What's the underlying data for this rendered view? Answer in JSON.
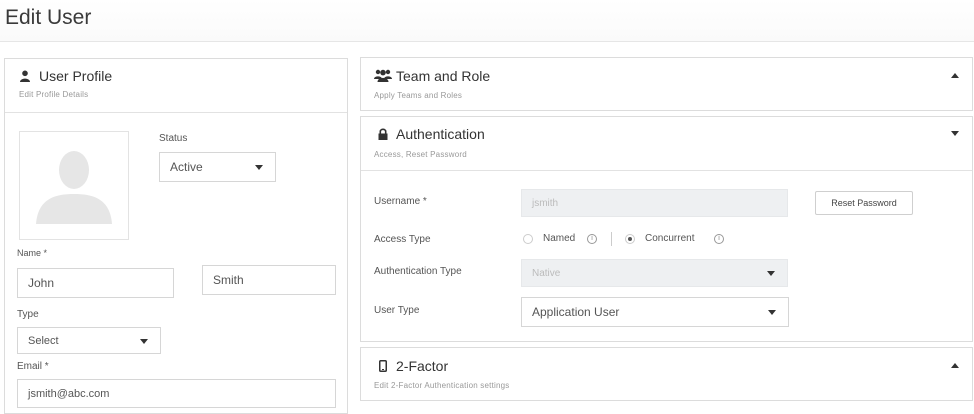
{
  "page": {
    "title": "Edit User"
  },
  "profile": {
    "title": "User Profile",
    "subtitle": "Edit Profile Details",
    "status_label": "Status",
    "status_value": "Active",
    "name_label": "Name *",
    "first_name": "John",
    "last_name": "Smith",
    "type_label": "Type",
    "type_value": "Select",
    "email_label": "Email *",
    "email_value": "jsmith@abc.com"
  },
  "team_role": {
    "title": "Team and Role",
    "subtitle": "Apply Teams and Roles"
  },
  "authentication": {
    "title": "Authentication",
    "subtitle": "Access, Reset Password",
    "username_label": "Username *",
    "username_placeholder": "jsmith",
    "reset_button": "Reset Password",
    "access_type_label": "Access Type",
    "access_named": "Named",
    "access_concurrent": "Concurrent",
    "access_selected": "Concurrent",
    "auth_type_label": "Authentication Type",
    "auth_type_value": "Native",
    "user_type_label": "User Type",
    "user_type_value": "Application User"
  },
  "two_factor": {
    "title": "2-Factor",
    "subtitle": "Edit 2-Factor Authentication settings"
  },
  "icons": {
    "profile": "user-icon",
    "team": "users-icon",
    "auth": "lock-icon",
    "two_factor": "mobile-icon"
  }
}
